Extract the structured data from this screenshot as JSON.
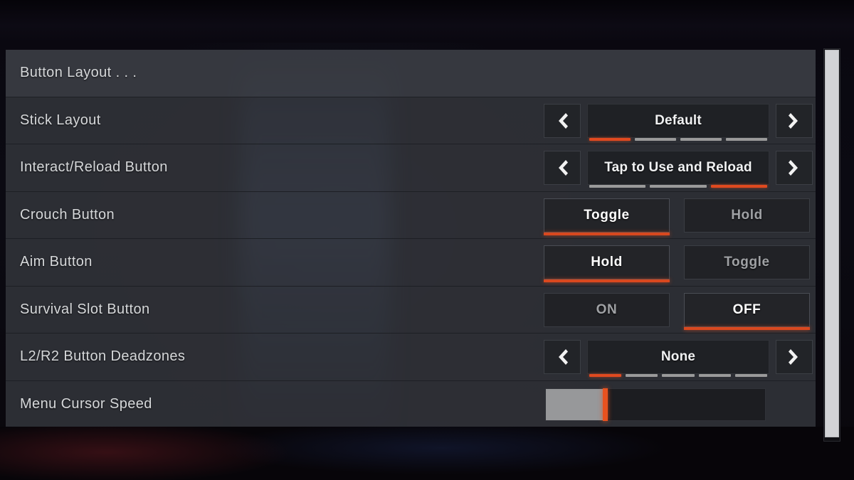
{
  "colors": {
    "accent": "#d9481f",
    "panel_bg": "#2c2e34",
    "row_bg": "#2f3137",
    "text": "#d6d8da",
    "text_bright": "#ffffff",
    "text_dim": "#9fa1a4",
    "segment_inactive": "#9a9a9a",
    "slider_fill": "#97989a",
    "scrollbar": "#d2d3d6"
  },
  "icons": {
    "left_arrow": "chevron-left-icon",
    "right_arrow": "chevron-right-icon"
  },
  "rows": [
    {
      "label": "Button Layout . . .",
      "type": "header",
      "selected": true
    },
    {
      "label": "Stick Layout",
      "type": "stepper",
      "value": "Default",
      "segments": 4,
      "active_segment": 1
    },
    {
      "label": "Interact/Reload Button",
      "type": "stepper",
      "value": "Tap to Use and Reload",
      "segments": 3,
      "active_segment": 3
    },
    {
      "label": "Crouch Button",
      "type": "options",
      "options": [
        "Toggle",
        "Hold"
      ],
      "selected_index": 0
    },
    {
      "label": "Aim Button",
      "type": "options",
      "options": [
        "Hold",
        "Toggle"
      ],
      "selected_index": 0
    },
    {
      "label": "Survival Slot Button",
      "type": "options",
      "options": [
        "ON",
        "OFF"
      ],
      "selected_index": 1
    },
    {
      "label": "L2/R2 Button Deadzones",
      "type": "stepper",
      "value": "None",
      "segments": 5,
      "active_segment": 1
    },
    {
      "label": "Menu Cursor Speed",
      "type": "slider",
      "fill_percent": 27
    }
  ],
  "scrollbar": {
    "thumb_percent": 99
  }
}
